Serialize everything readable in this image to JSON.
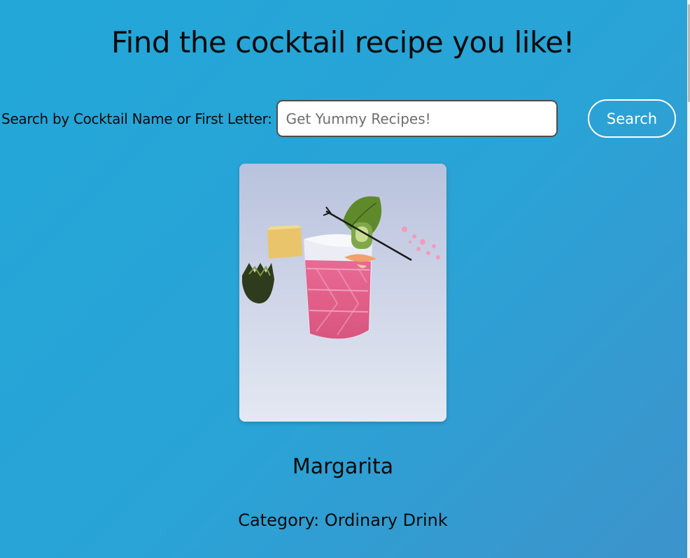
{
  "page": {
    "title": "Find the cocktail recipe you like!"
  },
  "search": {
    "label": "Search by Cocktail Name or First Letter:",
    "placeholder": "Get Yummy Recipes!",
    "value": "",
    "button_label": "Search"
  },
  "drink": {
    "name": "Margarita",
    "category_prefix": "Category:",
    "category": "Ordinary Drink",
    "category_text": "Category: Ordinary Drink",
    "image_icon": "cocktail-photo"
  },
  "colors": {
    "background_start": "#22a7d8",
    "background_end": "#3d93cb",
    "button_border": "#ffffff",
    "input_border": "#4d4d4d"
  }
}
